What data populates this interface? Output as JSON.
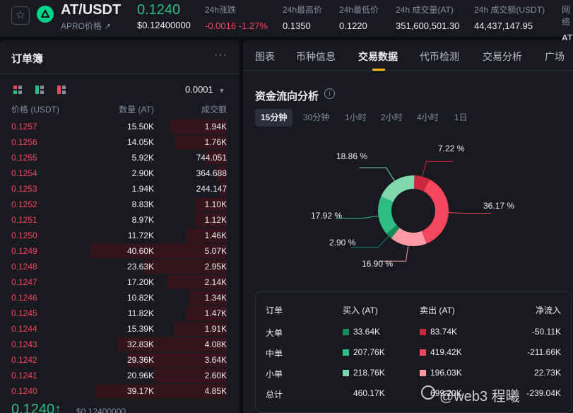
{
  "header": {
    "symbol": "AT/USDT",
    "subname": "APRO价格 ↗",
    "last_price": "0.1240",
    "usd_price": "$0.12400000",
    "stats": [
      {
        "label": "24h涨跌",
        "value": "-0.0016 -1.27%"
      },
      {
        "label": "24h最高价",
        "value": "0.1350"
      },
      {
        "label": "24h最低价",
        "value": "0.1220"
      },
      {
        "label": "24h 成交量(AT)",
        "value": "351,600,501.30"
      },
      {
        "label": "24h 成交额(USDT)",
        "value": "44,437,147.95"
      },
      {
        "label": "网络",
        "value": "AT"
      }
    ]
  },
  "orderbook": {
    "title": "订单簿",
    "more": "···",
    "tick": "0.0001",
    "col_price": "价格 (USDT)",
    "col_qty": "数量 (AT)",
    "col_total": "成交额",
    "rows": [
      {
        "price": "0.1257",
        "qty": "15.50K",
        "total": "1.94K",
        "depth": 0.32
      },
      {
        "price": "0.1256",
        "qty": "14.05K",
        "total": "1.76K",
        "depth": 0.29
      },
      {
        "price": "0.1255",
        "qty": "5.92K",
        "total": "744.051",
        "depth": 0.12
      },
      {
        "price": "0.1254",
        "qty": "2.90K",
        "total": "364.688",
        "depth": 0.06
      },
      {
        "price": "0.1253",
        "qty": "1.94K",
        "total": "244.147",
        "depth": 0.04
      },
      {
        "price": "0.1252",
        "qty": "8.83K",
        "total": "1.10K",
        "depth": 0.18
      },
      {
        "price": "0.1251",
        "qty": "8.97K",
        "total": "1.12K",
        "depth": 0.18
      },
      {
        "price": "0.1250",
        "qty": "11.72K",
        "total": "1.46K",
        "depth": 0.23
      },
      {
        "price": "0.1249",
        "qty": "40.60K",
        "total": "5.07K",
        "depth": 0.77
      },
      {
        "price": "0.1248",
        "qty": "23.63K",
        "total": "2.95K",
        "depth": 0.47
      },
      {
        "price": "0.1247",
        "qty": "17.20K",
        "total": "2.14K",
        "depth": 0.34
      },
      {
        "price": "0.1246",
        "qty": "10.82K",
        "total": "1.34K",
        "depth": 0.21
      },
      {
        "price": "0.1245",
        "qty": "11.82K",
        "total": "1.47K",
        "depth": 0.23
      },
      {
        "price": "0.1244",
        "qty": "15.39K",
        "total": "1.91K",
        "depth": 0.3
      },
      {
        "price": "0.1243",
        "qty": "32.83K",
        "total": "4.08K",
        "depth": 0.62
      },
      {
        "price": "0.1242",
        "qty": "29.36K",
        "total": "3.64K",
        "depth": 0.56
      },
      {
        "price": "0.1241",
        "qty": "20.96K",
        "total": "2.60K",
        "depth": 0.41
      },
      {
        "price": "0.1240",
        "qty": "39.17K",
        "total": "4.85K",
        "depth": 0.74
      }
    ],
    "bottom_price": "0.1240↑",
    "bottom_usd": "$0.12400000"
  },
  "tabs": [
    "图表",
    "币种信息",
    "交易数据",
    "代币检测",
    "交易分析",
    "广场"
  ],
  "active_tab": "交易数据",
  "flow_section": {
    "title": "资金流向分析",
    "periods": [
      "15分钟",
      "30分钟",
      "1小时",
      "2小时",
      "4小时",
      "1日"
    ],
    "active_period": "15分钟",
    "donut_labels": [
      "7.22 %",
      "36.17 %",
      "16.90 %",
      "2.90 %",
      "17.92 %",
      "18.86 %"
    ],
    "table": {
      "headers": [
        "订单",
        "买入 (AT)",
        "卖出 (AT)",
        "净流入"
      ],
      "rows": [
        {
          "name": "大单",
          "buy": "33.64K",
          "sell": "83.74K",
          "net": "-50.11K"
        },
        {
          "name": "中单",
          "buy": "207.76K",
          "sell": "419.42K",
          "net": "-211.66K"
        },
        {
          "name": "小单",
          "buy": "218.76K",
          "sell": "196.03K",
          "net": "22.73K"
        },
        {
          "name": "总计",
          "buy": "460.17K",
          "sell": "699.20K",
          "net": "-239.04K"
        }
      ]
    }
  },
  "watermark": "@web3 程曦",
  "colors": {
    "up": "#2ebd85",
    "down": "#f6465d",
    "accent": "#f0b90b",
    "big_buy": "#168a5a",
    "mid_buy": "#2ebd85",
    "small_buy": "#7fd7ae",
    "big_sell": "#c9283f",
    "mid_sell": "#f6465d",
    "small_sell": "#ff9aa5"
  },
  "chart_data": {
    "type": "pie",
    "categories": [
      "大单卖出",
      "中单卖出",
      "小单卖出",
      "大单买入",
      "中单买入",
      "小单买入"
    ],
    "values": [
      7.22,
      36.17,
      16.9,
      2.9,
      17.92,
      18.86
    ],
    "colors": [
      "#c9283f",
      "#f6465d",
      "#ff9aa5",
      "#168a5a",
      "#2ebd85",
      "#7fd7ae"
    ]
  }
}
